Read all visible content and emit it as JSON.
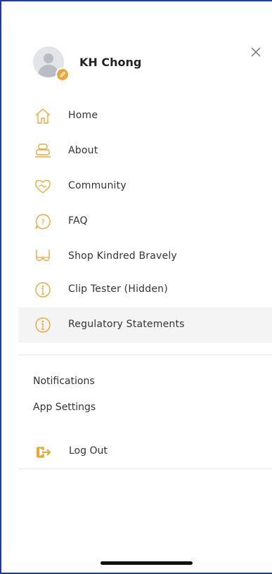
{
  "user": {
    "name": "KH Chong"
  },
  "menu": {
    "items": [
      {
        "label": "Home",
        "icon": "home-icon"
      },
      {
        "label": "About",
        "icon": "about-icon"
      },
      {
        "label": "Community",
        "icon": "community-icon"
      },
      {
        "label": "FAQ",
        "icon": "faq-icon"
      },
      {
        "label": "Shop Kindred Bravely",
        "icon": "bra-icon"
      },
      {
        "label": "Clip Tester (Hidden)",
        "icon": "info-icon"
      },
      {
        "label": "Regulatory Statements",
        "icon": "info-icon"
      }
    ]
  },
  "links": {
    "notifications": "Notifications",
    "app_settings": "App Settings"
  },
  "logout": {
    "label": "Log Out"
  },
  "colors": {
    "accent": "#E9A83A",
    "frame": "#1F3F8A",
    "active_bg": "#F4F4F5"
  }
}
